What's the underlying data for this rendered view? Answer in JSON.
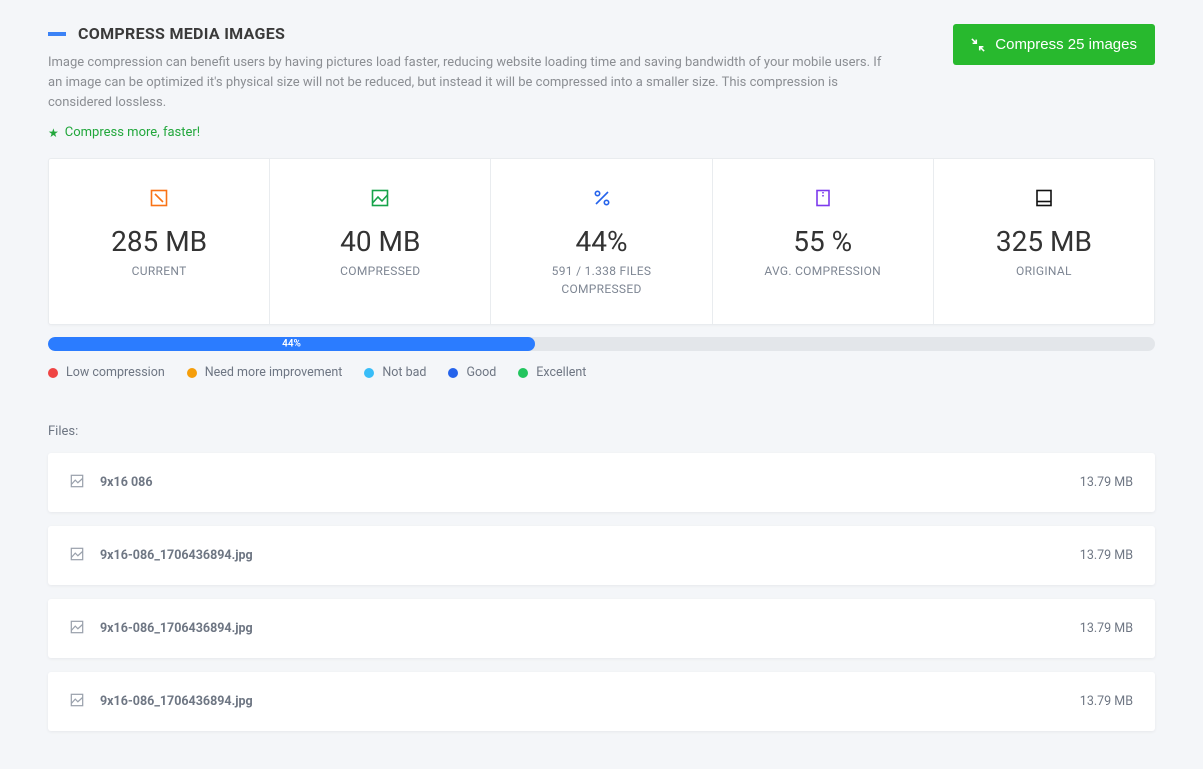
{
  "header": {
    "title": "COMPRESS MEDIA IMAGES",
    "description": "Image compression can benefit users by having pictures load faster, reducing website loading time and saving bandwidth of your mobile users. If an image can be optimized it's physical size will not be reduced, but instead it will be compressed into a smaller size. This compression is considered lossless.",
    "promo": "Compress more, faster!",
    "button_label": "Compress 25 images"
  },
  "stats": [
    {
      "value": "285 MB",
      "label": "CURRENT",
      "sublabel": "",
      "icon": "image-frame",
      "color": "#f97316"
    },
    {
      "value": "40 MB",
      "label": "COMPRESSED",
      "sublabel": "",
      "icon": "image",
      "color": "#16a34a"
    },
    {
      "value": "44%",
      "label": "591 / 1.338 FILES",
      "sublabel": "COMPRESSED",
      "icon": "percent",
      "color": "#2563eb"
    },
    {
      "value": "55 %",
      "label": "AVG. COMPRESSION",
      "sublabel": "",
      "icon": "zip",
      "color": "#7c3aed"
    },
    {
      "value": "325 MB",
      "label": "ORIGINAL",
      "sublabel": "",
      "icon": "device",
      "color": "#111111"
    }
  ],
  "progress": {
    "percent": 44,
    "text": "44%"
  },
  "legend": [
    {
      "label": "Low compression",
      "color": "#ef4444"
    },
    {
      "label": "Need more improvement",
      "color": "#f59e0b"
    },
    {
      "label": "Not bad",
      "color": "#38bdf8"
    },
    {
      "label": "Good",
      "color": "#2563eb"
    },
    {
      "label": "Excellent",
      "color": "#22c55e"
    }
  ],
  "files_label": "Files:",
  "files": [
    {
      "name": "9x16 086",
      "size": "13.79 MB"
    },
    {
      "name": "9x16-086_1706436894.jpg",
      "size": "13.79 MB"
    },
    {
      "name": "9x16-086_1706436894.jpg",
      "size": "13.79 MB"
    },
    {
      "name": "9x16-086_1706436894.jpg",
      "size": "13.79 MB"
    }
  ]
}
